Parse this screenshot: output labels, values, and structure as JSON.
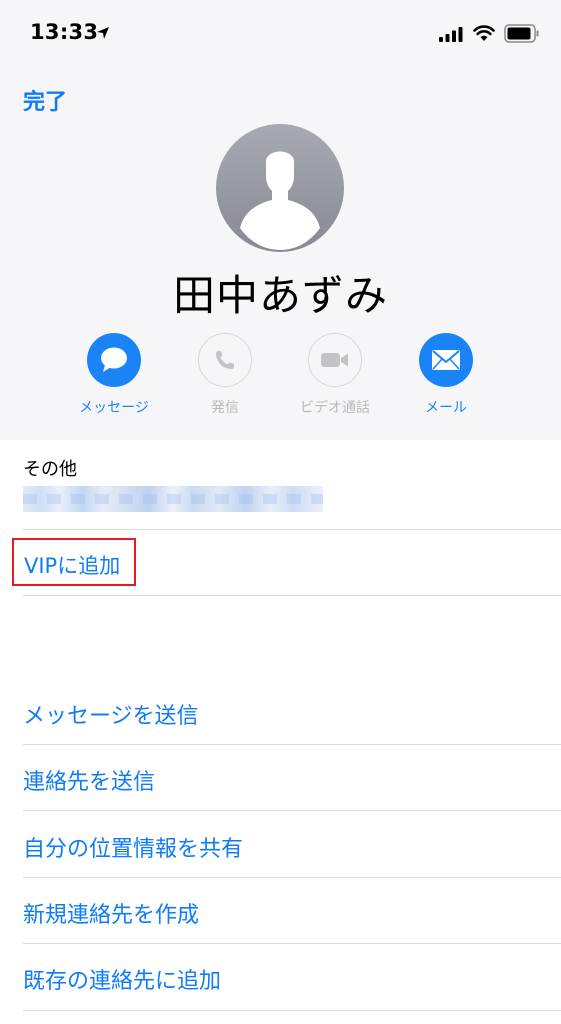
{
  "status_bar": {
    "time": "13:33"
  },
  "nav": {
    "done_label": "完了"
  },
  "contact": {
    "name": "田中あずみ"
  },
  "actions": [
    {
      "label": "メッセージ",
      "icon": "message-bubble-icon",
      "enabled": true
    },
    {
      "label": "発信",
      "icon": "phone-icon",
      "enabled": false
    },
    {
      "label": "ビデオ通話",
      "icon": "video-camera-icon",
      "enabled": false
    },
    {
      "label": "メール",
      "icon": "mail-envelope-icon",
      "enabled": true
    }
  ],
  "email_section": {
    "label": "その他"
  },
  "vip": {
    "label": "VIPに追加"
  },
  "menu": [
    {
      "label": "メッセージを送信"
    },
    {
      "label": "連絡先を送信"
    },
    {
      "label": "自分の位置情報を共有"
    },
    {
      "label": "新規連絡先を作成"
    },
    {
      "label": "既存の連絡先に追加"
    }
  ],
  "colors": {
    "accent": "#0f7cf5",
    "highlight_border": "#e31b23",
    "header_background": "#f6f6f9"
  }
}
